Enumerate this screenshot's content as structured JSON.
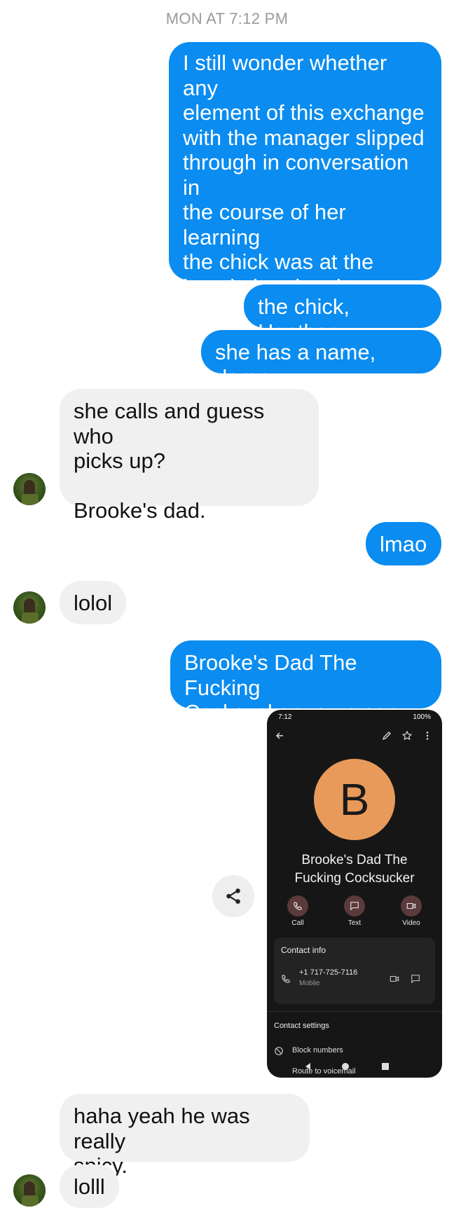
{
  "timestamp": "MON AT 7:12 PM",
  "messages": [
    {
      "text": "I still wonder whether any\nelement of this exchange\nwith the manager slipped\nthrough in conversation in\nthe course of her learning\nthe chick was at the\nhospital and no longer\nhaving a reason to pass\nthe number"
    },
    {
      "text": "the chick, Heather"
    },
    {
      "text": "she has a name, damn"
    },
    {
      "text": "she calls and guess who\npicks up?\n\nBrooke's dad."
    },
    {
      "text": "lmao"
    },
    {
      "text": "lolol"
    },
    {
      "text": "Brooke's Dad The Fucking\nCocksucker you mean"
    },
    {
      "text": "haha yeah he was really\nspicy."
    },
    {
      "text": "lolll"
    }
  ],
  "contact_screenshot": {
    "status_time": "7:12",
    "battery": "100%",
    "initial": "B",
    "name": "Brooke's Dad The\nFucking Cocksucker",
    "actions": [
      "Call",
      "Text",
      "Video"
    ],
    "contact_info_title": "Contact info",
    "phone_number": "+1 717-725-7116",
    "phone_type": "Mobile",
    "settings_title": "Contact settings",
    "block_label": "Block numbers",
    "route_label": "Route to voicemail"
  },
  "icons": {
    "share": "share-icon",
    "avatar": "contact-avatar-photo"
  },
  "colors": {
    "outgoing_bubble": "#0a8cf0",
    "incoming_bubble": "#f0f0f0",
    "contact_avatar": "#e89a5a"
  }
}
